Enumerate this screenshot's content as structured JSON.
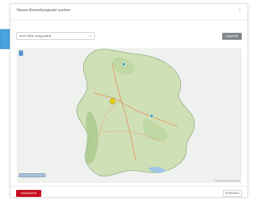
{
  "modal": {
    "title": "Neues Bewerbungsziel suchen",
    "close_glyph": "×"
  },
  "filter": {
    "value": "Kein Filter ausgewählt",
    "caret": "▾"
  },
  "legend_button": "Legende",
  "map": {
    "zoom_label": "+",
    "attribution": "© OpenStreetMap contributors",
    "markers": [
      {
        "name": "map-marker-north",
        "color": "#3aa6b9"
      },
      {
        "name": "map-marker-selected",
        "color": "#e8d200"
      },
      {
        "name": "map-marker-east",
        "color": "#3aa6b9"
      }
    ]
  },
  "footer": {
    "save_label": "Suchsuche",
    "close_label": "Schließen"
  },
  "colors": {
    "accent": "#c80f1e",
    "legend": "#7f878c",
    "arrow": "#4aa3df"
  }
}
